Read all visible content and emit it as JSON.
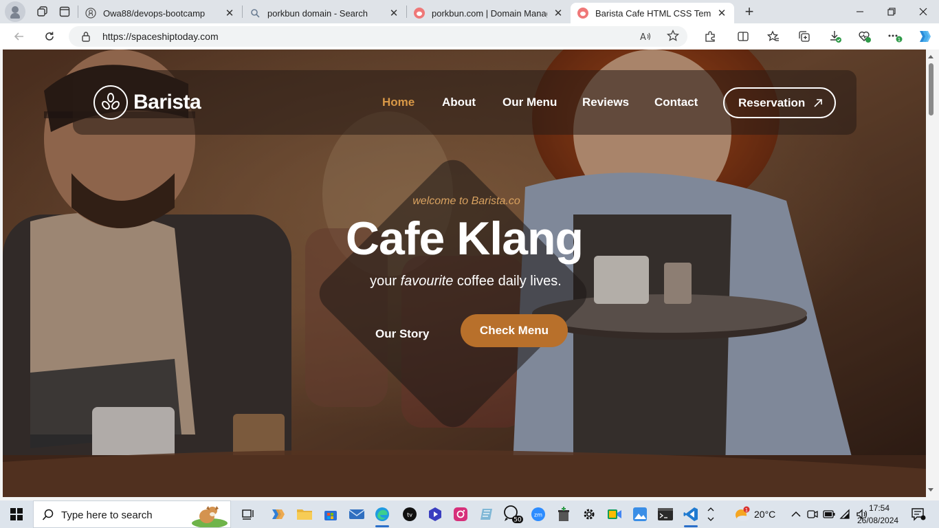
{
  "browser": {
    "tabs": [
      {
        "title": "Owa88/devops-bootcamp",
        "icon": "github-icon",
        "active": false
      },
      {
        "title": "porkbun domain - Search",
        "icon": "search-icon",
        "active": false
      },
      {
        "title": "porkbun.com | Domain Managem",
        "icon": "porkbun-icon",
        "active": false
      },
      {
        "title": "Barista Cafe HTML CSS Template",
        "icon": "porkbun-icon",
        "active": true
      }
    ],
    "url": "https://spaceshiptoday.com",
    "extension_badge": "1"
  },
  "site": {
    "brand": "Barista",
    "nav": [
      "Home",
      "About",
      "Our Menu",
      "Reviews",
      "Contact"
    ],
    "reservation_label": "Reservation",
    "hero": {
      "welcome": "welcome to Barista.co",
      "title": "Cafe Klang",
      "tagline_before": "your ",
      "tagline_emphasis": "favourite",
      "tagline_after": " coffee daily lives.",
      "story_label": "Our Story",
      "menu_label": "Check Menu"
    },
    "colors": {
      "accent": "#d99847",
      "button": "#b8702b"
    }
  },
  "taskbar": {
    "search_placeholder": "Type here to search",
    "whatsapp_badge": "50",
    "weather": "20°C",
    "weather_badge": "1",
    "time": "17:54",
    "date": "26/08/2024"
  }
}
